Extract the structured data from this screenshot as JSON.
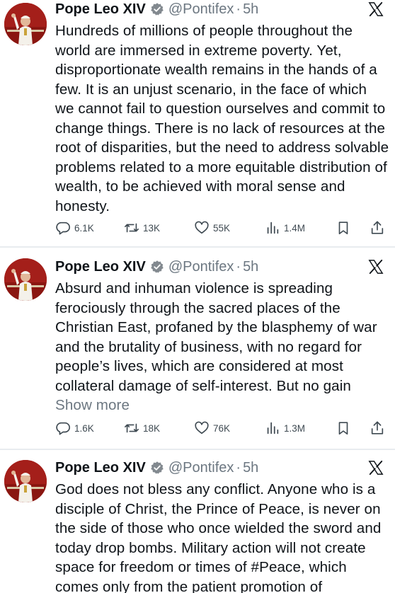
{
  "tweets": [
    {
      "author_name": "Pope Leo XIV",
      "handle": "@Pontifex",
      "separator": "·",
      "time": "5h",
      "text": "Hundreds of millions of people throughout the world are immersed in extreme poverty. Yet, disproportionate wealth remains in the hands of a few. It is an unjust scenario, in the face of which we cannot fail to question ourselves and commit to change things. There is no lack of resources at the root of disparities, but the need to address solvable problems related to a more equitable distribution of wealth, to be achieved with moral sense and honesty.",
      "show_more": "",
      "replies": "6.1K",
      "reposts": "13K",
      "likes": "55K",
      "views": "1.4M"
    },
    {
      "author_name": "Pope Leo XIV",
      "handle": "@Pontifex",
      "separator": "·",
      "time": "5h",
      "text": "Absurd and inhuman violence is spreading ferociously through the sacred places of the Christian East, profaned by the blasphemy of war and the brutality of business, with no regard for people’s lives, which are considered at most collateral damage of self-interest. But no gain ",
      "show_more": "Show more",
      "replies": "1.6K",
      "reposts": "18K",
      "likes": "76K",
      "views": "1.3M"
    },
    {
      "author_name": "Pope Leo XIV",
      "handle": "@Pontifex",
      "separator": "·",
      "time": "5h",
      "text": "God does not bless any conflict. Anyone who is a disciple of Christ, the Prince of Peace, is never on the side of those who once wielded the sword and today drop bombs. Military action will not create space for freedom or times of #Peace, which comes only from the patient promotion of",
      "show_more": "",
      "replies": "",
      "reposts": "",
      "likes": "",
      "views": ""
    }
  ],
  "icons": {
    "verified": "verified-badge-icon",
    "platform": "x-logo-icon",
    "reply": "reply-icon",
    "repost": "repost-icon",
    "like": "heart-icon",
    "views": "views-icon",
    "bookmark": "bookmark-icon",
    "share": "share-icon"
  },
  "colors": {
    "text": "#0f1419",
    "muted": "#6c7781",
    "action": "#3f4a52",
    "divider": "#e8ecef",
    "avatar_bg": "#a41f1a"
  }
}
